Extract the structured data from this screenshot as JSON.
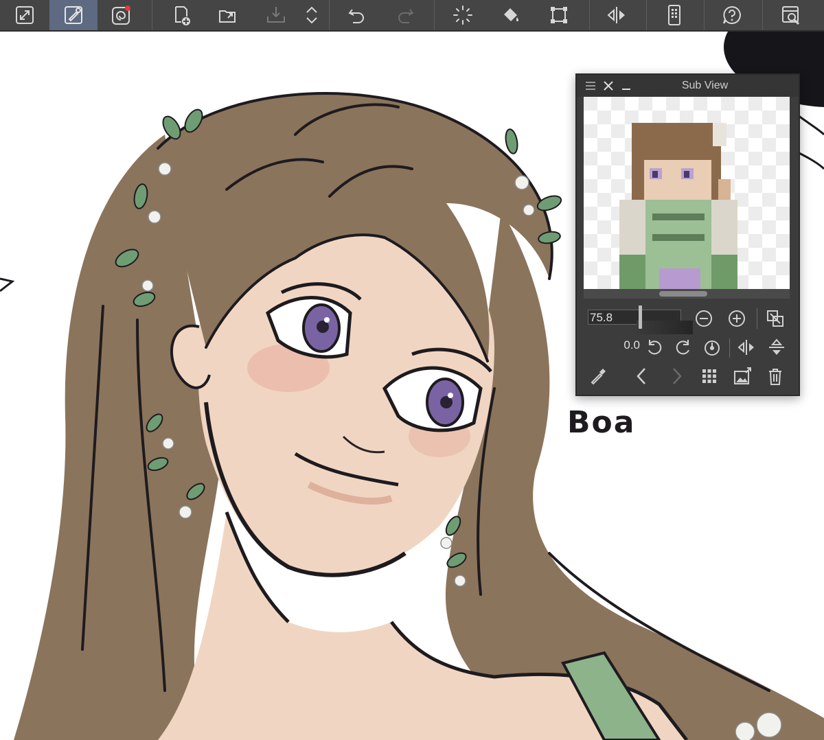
{
  "toolbar": {
    "buttons": [
      {
        "name": "fullscreen-icon"
      },
      {
        "name": "brush-pencil-icon"
      },
      {
        "name": "spiral-app-icon"
      },
      {
        "name": "new-canvas-icon"
      },
      {
        "name": "open-folder-icon"
      },
      {
        "name": "save-export-icon"
      },
      {
        "name": "up-down-arrows-icon"
      },
      {
        "name": "undo-icon"
      },
      {
        "name": "redo-icon"
      },
      {
        "name": "loading-spinner-icon"
      },
      {
        "name": "fill-bucket-icon"
      },
      {
        "name": "transform-icon"
      },
      {
        "name": "flip-horizontal-icon"
      },
      {
        "name": "device-icon"
      },
      {
        "name": "help-icon"
      },
      {
        "name": "search-settings-icon"
      }
    ],
    "active_button": "brush-pencil-icon",
    "accent": "#5d6a82",
    "notification_dot": "#e23b3b"
  },
  "canvas": {
    "signature": "Boa",
    "colors": {
      "hair": "#8b745c",
      "skin": "#f0d6c2",
      "eyes": "#7a63a3",
      "leaves": "#6f9d73",
      "outline": "#1e1b1f"
    }
  },
  "subview": {
    "title": "Sub View",
    "zoom_value": "75.8",
    "rotation_value": "0.0"
  }
}
